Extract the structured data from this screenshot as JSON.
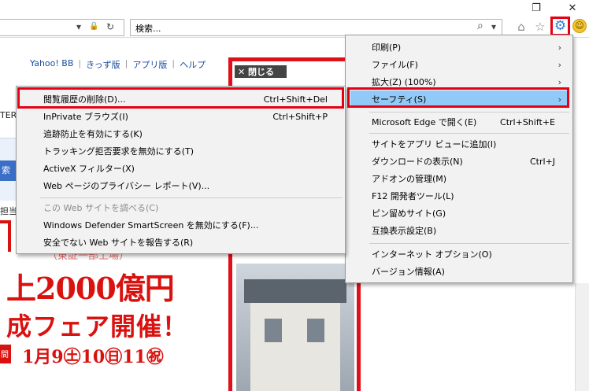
{
  "window": {
    "restore_glyph": "❐",
    "close_glyph": "✕"
  },
  "addressbar": {
    "lock_glyph": "🔒",
    "refresh_glyph": "↻",
    "dropdown_glyph": "▾"
  },
  "search": {
    "placeholder": "検索...",
    "search_glyph": "⌕",
    "dropdown_glyph": "▾"
  },
  "toolbar": {
    "home_glyph": "⌂",
    "star_glyph": "☆",
    "gear_glyph": "⚙",
    "smiley_glyph": "☺"
  },
  "page": {
    "links": [
      "Yahoo! BB",
      "きっず版",
      "アプリ版",
      "ヘルプ"
    ],
    "link_separator": "|",
    "fragment_ter": "TER",
    "fragment_search_button": "索",
    "fragment_role": "担当",
    "close_button": "✕ 閉じる",
    "ad_small": "（東証一部上場）",
    "ad_line1": "上2000億円",
    "ad_line2": "成フェア開催！",
    "ad_line3": "1月9㊏10㊐11㊗",
    "ad_tag": "間"
  },
  "main_menu": {
    "items": [
      {
        "label": "印刷(P)",
        "shortcut": "",
        "arrow": "›"
      },
      {
        "label": "ファイル(F)",
        "shortcut": "",
        "arrow": "›"
      },
      {
        "label": "拡大(Z) (100%)",
        "shortcut": "",
        "arrow": "›"
      },
      {
        "label": "セーフティ(S)",
        "shortcut": "",
        "arrow": "›"
      },
      {
        "label": "Microsoft Edge で開く(E)",
        "shortcut": "Ctrl+Shift+E",
        "arrow": ""
      },
      {
        "label": "サイトをアプリ ビューに追加(I)",
        "shortcut": "",
        "arrow": ""
      },
      {
        "label": "ダウンロードの表示(N)",
        "shortcut": "Ctrl+J",
        "arrow": ""
      },
      {
        "label": "アドオンの管理(M)",
        "shortcut": "",
        "arrow": ""
      },
      {
        "label": "F12 開発者ツール(L)",
        "shortcut": "",
        "arrow": ""
      },
      {
        "label": "ピン留めサイト(G)",
        "shortcut": "",
        "arrow": ""
      },
      {
        "label": "互換表示設定(B)",
        "shortcut": "",
        "arrow": ""
      },
      {
        "label": "インターネット オプション(O)",
        "shortcut": "",
        "arrow": ""
      },
      {
        "label": "バージョン情報(A)",
        "shortcut": "",
        "arrow": ""
      }
    ]
  },
  "safety_submenu": {
    "items": [
      {
        "label": "閲覧履歴の削除(D)...",
        "shortcut": "Ctrl+Shift+Del",
        "enabled": true
      },
      {
        "label": "InPrivate ブラウズ(I)",
        "shortcut": "Ctrl+Shift+P",
        "enabled": true
      },
      {
        "label": "追跡防止を有効にする(K)",
        "shortcut": "",
        "enabled": true
      },
      {
        "label": "トラッキング拒否要求を無効にする(T)",
        "shortcut": "",
        "enabled": true
      },
      {
        "label": "ActiveX フィルター(X)",
        "shortcut": "",
        "enabled": true
      },
      {
        "label": "Web ページのプライバシー レポート(V)...",
        "shortcut": "",
        "enabled": true
      },
      {
        "label": "この Web サイトを調べる(C)",
        "shortcut": "",
        "enabled": false
      },
      {
        "label": "Windows Defender SmartScreen を無効にする(F)...",
        "shortcut": "",
        "enabled": true
      },
      {
        "label": "安全でない Web サイトを報告する(R)",
        "shortcut": "",
        "enabled": true
      }
    ]
  },
  "colors": {
    "annotation_red": "#e60012",
    "menu_highlight": "#91c9f7",
    "gear_blue": "#2b7cd3"
  }
}
